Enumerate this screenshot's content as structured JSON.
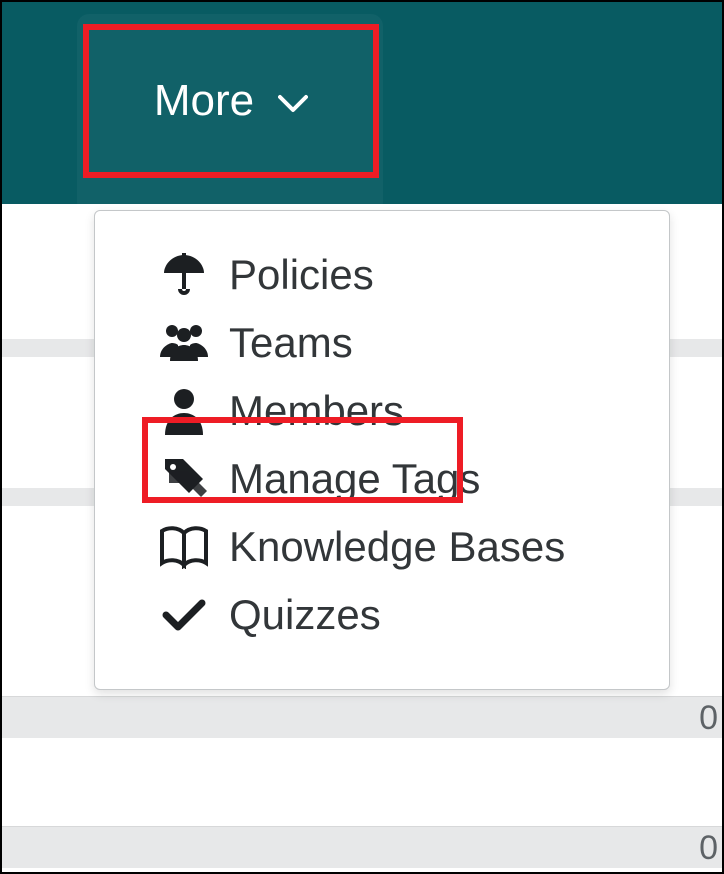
{
  "colors": {
    "header_bg": "#085b62",
    "highlight": "#ee1c25",
    "text": "#323639"
  },
  "header": {
    "more_label": "More"
  },
  "menu": {
    "items": [
      {
        "icon": "umbrella-icon",
        "label": "Policies"
      },
      {
        "icon": "users-icon",
        "label": "Teams"
      },
      {
        "icon": "user-icon",
        "label": "Members",
        "highlighted": true
      },
      {
        "icon": "tags-icon",
        "label": "Manage Tags"
      },
      {
        "icon": "book-icon",
        "label": "Knowledge Bases"
      },
      {
        "icon": "check-icon",
        "label": "Quizzes"
      }
    ]
  },
  "background_counts": {
    "row1": "0",
    "row2": "0"
  }
}
